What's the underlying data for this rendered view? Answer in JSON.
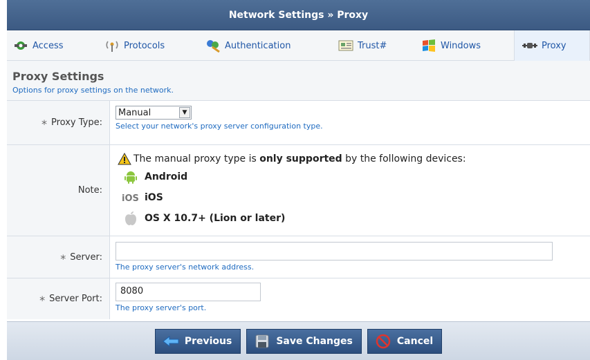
{
  "header": {
    "title": "Network Settings » Proxy"
  },
  "tabs": [
    {
      "label": "Access",
      "icon": "access-icon"
    },
    {
      "label": "Protocols",
      "icon": "protocols-icon"
    },
    {
      "label": "Authentication",
      "icon": "authentication-icon"
    },
    {
      "label": "Trust#",
      "icon": "trust-icon"
    },
    {
      "label": "Windows",
      "icon": "windows-icon"
    },
    {
      "label": "Proxy",
      "icon": "proxy-icon",
      "active": true
    }
  ],
  "section": {
    "title": "Proxy Settings",
    "description": "Options for proxy settings on the network."
  },
  "form": {
    "proxy_type": {
      "required": "*",
      "label": "Proxy Type:",
      "value": "Manual",
      "hint": "Select your network's proxy server configuration type."
    },
    "note": {
      "label": "Note:",
      "text_before": "The manual proxy type is ",
      "text_bold": "only supported",
      "text_after": " by the following devices:",
      "devices": [
        {
          "name": "Android",
          "icon": "android-icon"
        },
        {
          "name": "iOS",
          "icon": "ios-icon"
        },
        {
          "name": "OS X 10.7+ (Lion or later)",
          "icon": "apple-icon"
        }
      ]
    },
    "server": {
      "required": "*",
      "label": "Server:",
      "value": "",
      "hint": "The proxy server's network address."
    },
    "server_port": {
      "required": "*",
      "label": "Server Port:",
      "value": "8080",
      "hint": "The proxy server's port."
    }
  },
  "footer": {
    "previous_label": "Previous",
    "save_label": "Save Changes",
    "cancel_label": "Cancel"
  },
  "colors": {
    "title_bar": "#3f5f8a",
    "link_blue": "#1f56a6",
    "hint_blue": "#1f6bc0",
    "button_blue": "#2c4e7d"
  }
}
